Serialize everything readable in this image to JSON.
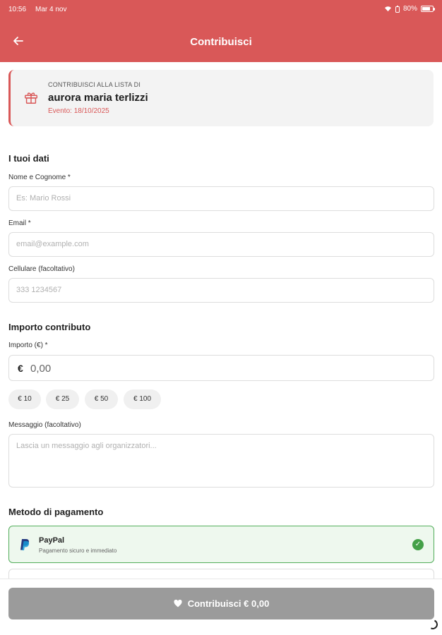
{
  "status_bar": {
    "time": "10:56",
    "date": "Mar 4 nov",
    "battery": "80%",
    "battery_level": 0.8
  },
  "header": {
    "title": "Contribuisci",
    "bg_color": "#d95858"
  },
  "event_card": {
    "label": "CONTRIBUISCI ALLA LISTA DI",
    "name": "aurora maria terlizzi",
    "date": "Evento: 18/10/2025",
    "icon": "gift-icon"
  },
  "personal": {
    "section_title": "I tuoi dati",
    "name_label": "Nome e Cognome *",
    "name_placeholder": "Es: Mario Rossi",
    "email_label": "Email *",
    "email_placeholder": "email@example.com",
    "phone_label": "Cellulare (facoltativo)",
    "phone_placeholder": "333 1234567"
  },
  "amount": {
    "section_title": "Importo contributo",
    "label": "Importo (€) *",
    "currency": "€",
    "value": "0,00",
    "presets": [
      "€ 10",
      "€ 25",
      "€ 50",
      "€ 100"
    ]
  },
  "message": {
    "label": "Messaggio (facoltativo)",
    "placeholder": "Lascia un messaggio agli organizzatori..."
  },
  "payment": {
    "section_title": "Metodo di pagamento",
    "options": [
      {
        "name": "PayPal",
        "description": "Pagamento sicuro e immediato",
        "selected": true
      }
    ],
    "selected_color": "#52ad5a"
  },
  "cta": {
    "label": "Contribuisci € 0,00",
    "color": "#9b9b9b"
  }
}
